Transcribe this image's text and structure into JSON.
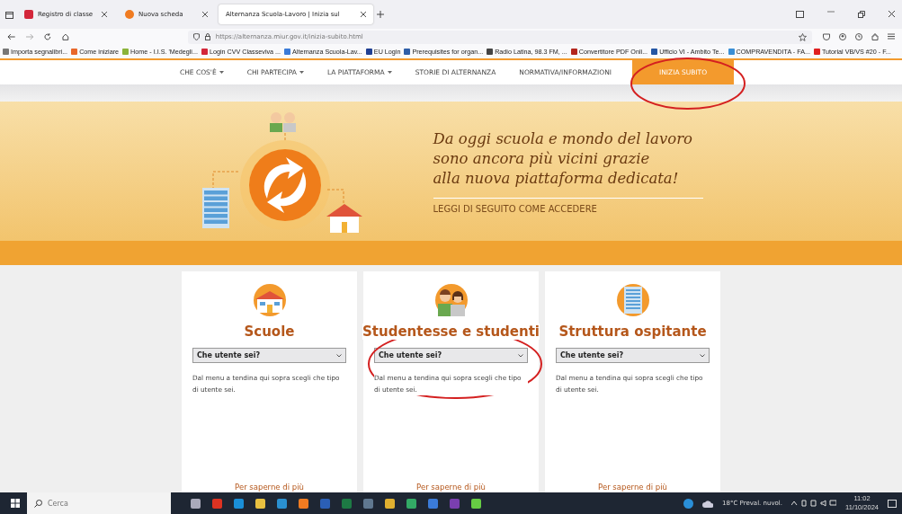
{
  "browser_tabs": [
    {
      "title": "Registro di classe",
      "selected": false
    },
    {
      "title": "Nuova scheda",
      "selected": false
    },
    {
      "title": "Alternanza Scuola-Lavoro | Inizia sul",
      "selected": true
    }
  ],
  "address_bar": {
    "url": "https://alternanza.miur.gov.it/inizia-subito.html"
  },
  "bookmarks": [
    {
      "label": "Importa segnalibri...",
      "color": "#777777"
    },
    {
      "label": "Come iniziare",
      "color": "#e8672a"
    },
    {
      "label": "Home - I.I.S. 'Medegli...",
      "color": "#8bb33a"
    },
    {
      "label": "Login CVV Classeviva ...",
      "color": "#d3263a"
    },
    {
      "label": "Alternanza Scuola-Lav...",
      "color": "#3b7bd8"
    },
    {
      "label": "EU Login",
      "color": "#1f3f93"
    },
    {
      "label": "Prerequisites for organ...",
      "color": "#2f5fa8"
    },
    {
      "label": "Radio Latina, 98.3 FM, ...",
      "color": "#444444"
    },
    {
      "label": "Convertitore PDF Onli...",
      "color": "#b3261e"
    },
    {
      "label": "Ufficio VI - Ambito Te...",
      "color": "#2456a4"
    },
    {
      "label": "COMPRAVENDITA - FA...",
      "color": "#3a8fd6"
    },
    {
      "label": "Tutorial VB/VS #20 - F...",
      "color": "#e02020"
    }
  ],
  "nav": [
    {
      "label": "CHE COS'È",
      "dropdown": true,
      "selected": false
    },
    {
      "label": "CHI PARTECIPA",
      "dropdown": true,
      "selected": false
    },
    {
      "label": "LA PIATTAFORMA",
      "dropdown": true,
      "selected": false
    },
    {
      "label": "STORIE DI ALTERNANZA",
      "dropdown": false,
      "selected": false
    },
    {
      "label": "NORMATIVA/INFORMAZIONI",
      "dropdown": false,
      "selected": false
    },
    {
      "label": "INIZIA SUBITO",
      "dropdown": false,
      "selected": true
    }
  ],
  "hero": {
    "lines": [
      "Da oggi scuola e mondo del lavoro",
      "sono ancora più vicini grazie",
      "alla nuova piattaforma dedicata!"
    ],
    "link": "LEGGI DI SEGUITO COME ACCEDERE"
  },
  "cards": [
    {
      "kind": "school",
      "title": "Scuole",
      "select": "Che utente sei?",
      "description": "Dal menu a tendina qui sopra scegli che tipo di utente sei.",
      "link": "Per saperne di più"
    },
    {
      "kind": "students",
      "title": "Studentesse e studenti",
      "select": "Che utente sei?",
      "description": "Dal menu a tendina qui sopra scegli che tipo di utente sei.",
      "link": "Per saperne di più"
    },
    {
      "kind": "building",
      "title": "Struttura ospitante",
      "select": "Che utente sei?",
      "description": "Dal menu a tendina qui sopra scegli che tipo di utente sei.",
      "link": "Per saperne di più"
    }
  ],
  "taskbar": {
    "search_placeholder": "Cerca",
    "weather": "18°C Preval. nuvol.",
    "time": "11:02",
    "date": "11/10/2024"
  }
}
